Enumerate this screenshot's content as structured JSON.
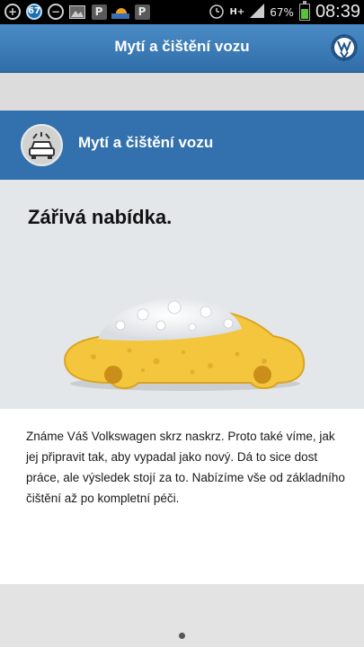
{
  "status_bar": {
    "icons": [
      "plus-icon",
      "notification-count-icon",
      "minus-icon",
      "image-icon",
      "parking-icon",
      "weather-icon",
      "parking-icon",
      "alarm-icon",
      "network-icon",
      "signal-icon",
      "battery-icon"
    ],
    "notification_count": "67",
    "network": "H+",
    "battery": "67%",
    "time": "08:39"
  },
  "header": {
    "title": "Mytí a čištění vozu",
    "logo": "vw-logo-icon"
  },
  "section": {
    "icon": "car-wash-icon",
    "title": "Mytí a čištění vozu"
  },
  "hero": {
    "headline": "Zářivá nabídka."
  },
  "description": {
    "text": "Známe Váš Volkswagen skrz naskrz. Proto také víme, jak jej připravit tak, aby vypadal jako nový. Dá to sice dost práce, ale výsledek stojí za to. Nabízíme vše od základního čištění až po kompletní péči."
  },
  "pager": {
    "total": 1,
    "current": 1
  },
  "colors": {
    "status_bar": "#000000",
    "title_bar": "#3d7db8",
    "section": "#3271ad",
    "hero_bg": "#e4e7ea",
    "sponge": "#f3c63d",
    "battery": "#59c13b"
  }
}
